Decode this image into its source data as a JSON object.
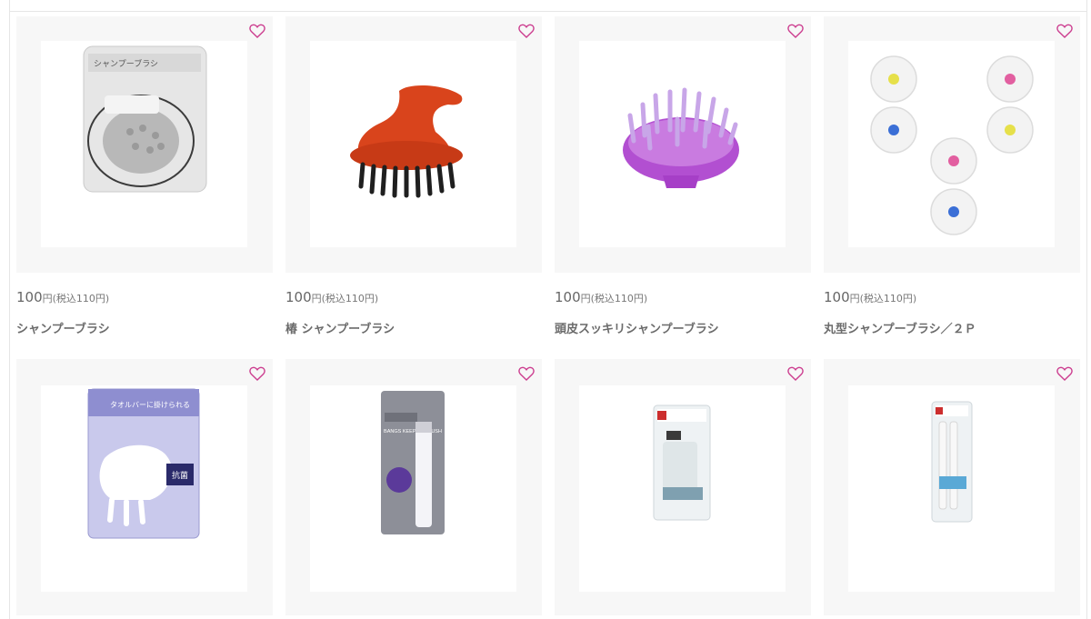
{
  "colors": {
    "heart": "#cc3d8f",
    "card_bg": "#f7f7f7",
    "text": "#666666"
  },
  "products": [
    {
      "icon": "packaged-shampoo-brush-image",
      "price": "100",
      "price_unit": "円",
      "tax_note": "(税込110円)",
      "name": "シャンプーブラシ",
      "package_text": "シャンプーブラシ"
    },
    {
      "icon": "orange-shampoo-brush-image",
      "price": "100",
      "price_unit": "円",
      "tax_note": "(税込110円)",
      "name": "椿 シャンプーブラシ"
    },
    {
      "icon": "purple-shampoo-brush-image",
      "price": "100",
      "price_unit": "円",
      "tax_note": "(税込110円)",
      "name": "頭皮スッキリシャンプーブラシ"
    },
    {
      "icon": "round-shampoo-brushes-image",
      "price": "100",
      "price_unit": "円",
      "tax_note": "(税込110円)",
      "name": "丸型シャンプーブラシ／２Ｐ"
    },
    {
      "icon": "towel-bar-shampoo-brush-image",
      "package_text": "タオルバーに掛けられる",
      "badge": "抗菌"
    },
    {
      "icon": "bangs-keeper-brush-image",
      "package_text": "BANGS KEEPER BRUSH"
    },
    {
      "icon": "travel-bottle-set-image"
    },
    {
      "icon": "travel-tube-set-image"
    }
  ]
}
